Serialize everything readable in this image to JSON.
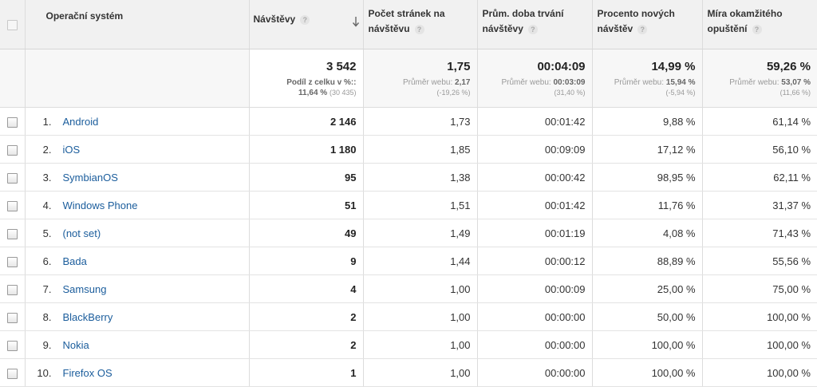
{
  "header": {
    "os": "Operační systém",
    "visits": "Návštěvy",
    "pages_per_visit": [
      "Počet stránek na",
      "návštěvu"
    ],
    "avg_duration": [
      "Prům. doba trvání",
      "návštěvy"
    ],
    "new_visits_pct": [
      "Procento nových",
      "návštěv"
    ],
    "bounce_rate": [
      "Míra okamžitého",
      "opuštění"
    ],
    "help_glyph": "?"
  },
  "totals": {
    "visits": "3 542",
    "visits_sub_label": "Podíl z celku v %::",
    "visits_sub_value": "11,64 %",
    "visits_sub_extra": "(30 435)",
    "pages_per_visit": "1,75",
    "pages_sub_label": "Průměr webu:",
    "pages_sub_value": "2,17",
    "pages_sub_extra": "(-19,26 %)",
    "avg_duration": "00:04:09",
    "duration_sub_label": "Průměr webu:",
    "duration_sub_value": "00:03:09",
    "duration_sub_extra": "(31,40 %)",
    "new_visits_pct": "14,99 %",
    "new_sub_label": "Průměr webu:",
    "new_sub_value": "15,94 %",
    "new_sub_extra": "(-5,94 %)",
    "bounce_rate": "59,26 %",
    "bounce_sub_label": "Průměr webu:",
    "bounce_sub_value": "53,07 %",
    "bounce_sub_extra": "(11,66 %)"
  },
  "rows": [
    {
      "idx": "1.",
      "os": "Android",
      "visits": "2 146",
      "pages": "1,73",
      "duration": "00:01:42",
      "new": "9,88 %",
      "bounce": "61,14 %"
    },
    {
      "idx": "2.",
      "os": "iOS",
      "visits": "1 180",
      "pages": "1,85",
      "duration": "00:09:09",
      "new": "17,12 %",
      "bounce": "56,10 %"
    },
    {
      "idx": "3.",
      "os": "SymbianOS",
      "visits": "95",
      "pages": "1,38",
      "duration": "00:00:42",
      "new": "98,95 %",
      "bounce": "62,11 %"
    },
    {
      "idx": "4.",
      "os": "Windows Phone",
      "visits": "51",
      "pages": "1,51",
      "duration": "00:01:42",
      "new": "11,76 %",
      "bounce": "31,37 %"
    },
    {
      "idx": "5.",
      "os": "(not set)",
      "visits": "49",
      "pages": "1,49",
      "duration": "00:01:19",
      "new": "4,08 %",
      "bounce": "71,43 %"
    },
    {
      "idx": "6.",
      "os": "Bada",
      "visits": "9",
      "pages": "1,44",
      "duration": "00:00:12",
      "new": "88,89 %",
      "bounce": "55,56 %"
    },
    {
      "idx": "7.",
      "os": "Samsung",
      "visits": "4",
      "pages": "1,00",
      "duration": "00:00:09",
      "new": "25,00 %",
      "bounce": "75,00 %"
    },
    {
      "idx": "8.",
      "os": "BlackBerry",
      "visits": "2",
      "pages": "1,00",
      "duration": "00:00:00",
      "new": "50,00 %",
      "bounce": "100,00 %"
    },
    {
      "idx": "9.",
      "os": "Nokia",
      "visits": "2",
      "pages": "1,00",
      "duration": "00:00:00",
      "new": "100,00 %",
      "bounce": "100,00 %"
    },
    {
      "idx": "10.",
      "os": "Firefox OS",
      "visits": "1",
      "pages": "1,00",
      "duration": "00:00:00",
      "new": "100,00 %",
      "bounce": "100,00 %"
    }
  ],
  "colors": {
    "link": "#1b5d9c",
    "header_bg": "#f1f1f1",
    "border": "#dcdcdc"
  },
  "icons": {
    "sort": "sort-descending-arrow-icon",
    "help": "help-question-icon",
    "checkbox": "checkbox-icon"
  }
}
